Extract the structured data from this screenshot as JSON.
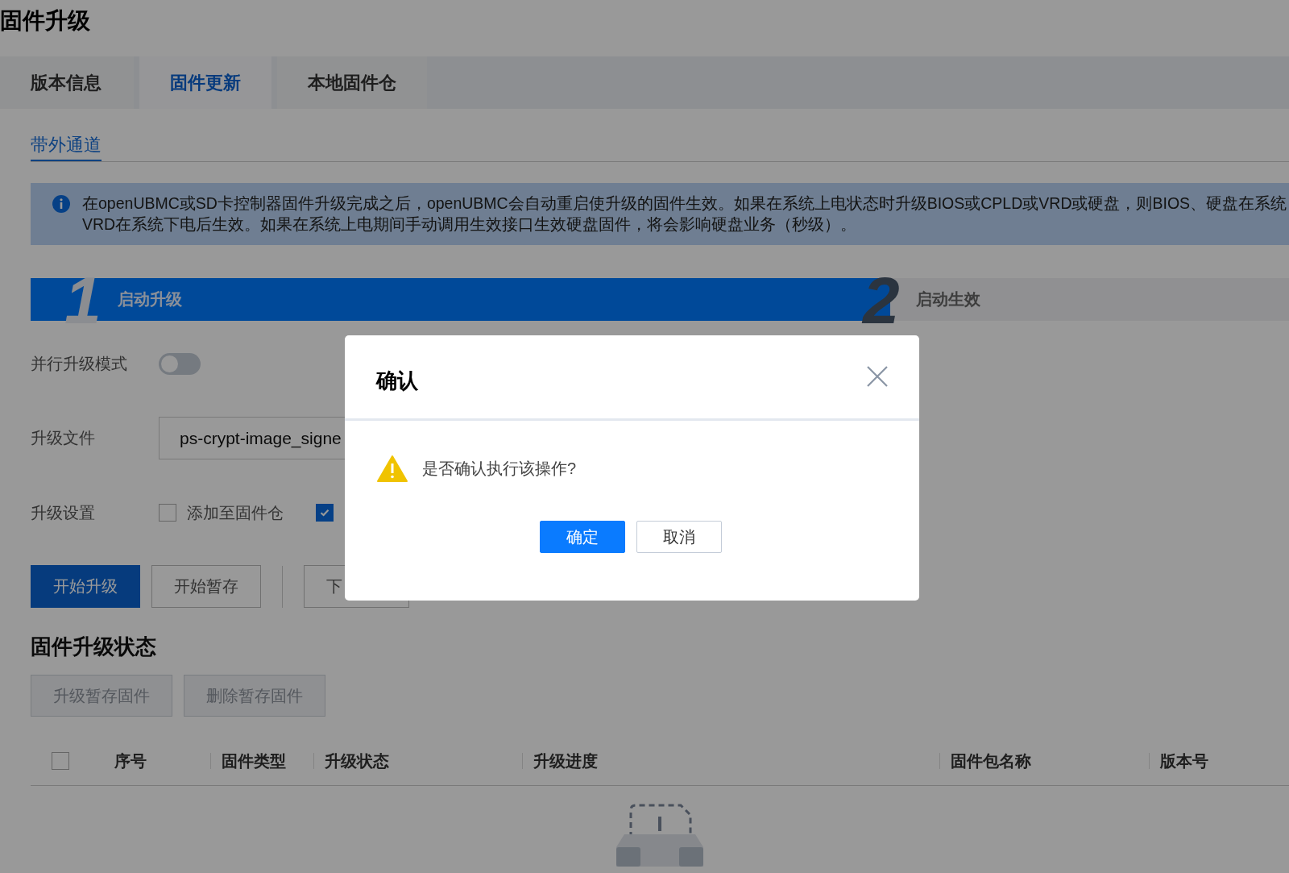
{
  "page_title": "固件升级",
  "tabs": [
    {
      "label": "版本信息",
      "selected": false
    },
    {
      "label": "固件更新",
      "selected": true
    },
    {
      "label": "本地固件仓",
      "selected": false
    }
  ],
  "subtabs": [
    {
      "label": "带外通道",
      "selected": true
    }
  ],
  "notice": {
    "lines": [
      "在openUBMC或SD卡控制器固件升级完成之后，openUBMC会自动重启使升级的固件生效。如果在系统上电状态时升级BIOS或CPLD或VRD或硬盘，则BIOS、硬盘在系统",
      "VRD在系统下电后生效。如果在系统上电期间手动调用生效接口生效硬盘固件，将会影响硬盘业务（秒级）。"
    ]
  },
  "steps": [
    {
      "number": "1",
      "label": "启动升级",
      "active": true
    },
    {
      "number": "2",
      "label": "启动生效",
      "active": false
    }
  ],
  "form": {
    "parallel_mode": {
      "label": "并行升级模式",
      "on": false
    },
    "upgrade_file": {
      "label": "升级文件",
      "value": "ps-crypt-image_signe"
    },
    "settings": {
      "label": "升级设置",
      "options": [
        {
          "label": "添加至固件仓",
          "checked": false
        },
        {
          "checked": true
        }
      ]
    }
  },
  "actions": [
    {
      "label": "开始升级",
      "kind": "primary"
    },
    {
      "label": "开始暂存",
      "kind": "default"
    },
    {
      "kind": "divider"
    },
    {
      "label": "下",
      "kind": "default"
    }
  ],
  "status_section": {
    "title": "固件升级状态",
    "buttons": [
      {
        "label": "升级暂存固件",
        "disabled": true
      },
      {
        "label": "删除暂存固件",
        "disabled": true
      }
    ],
    "table": {
      "select_all_checked": false,
      "columns": [
        "序号",
        "固件类型",
        "升级状态",
        "升级进度",
        "固件包名称",
        "版本号"
      ]
    }
  },
  "dialog": {
    "title": "确认",
    "message": "是否确认执行该操作?",
    "buttons": [
      {
        "label": "确定",
        "kind": "primary"
      },
      {
        "label": "取消",
        "kind": "default"
      }
    ]
  }
}
